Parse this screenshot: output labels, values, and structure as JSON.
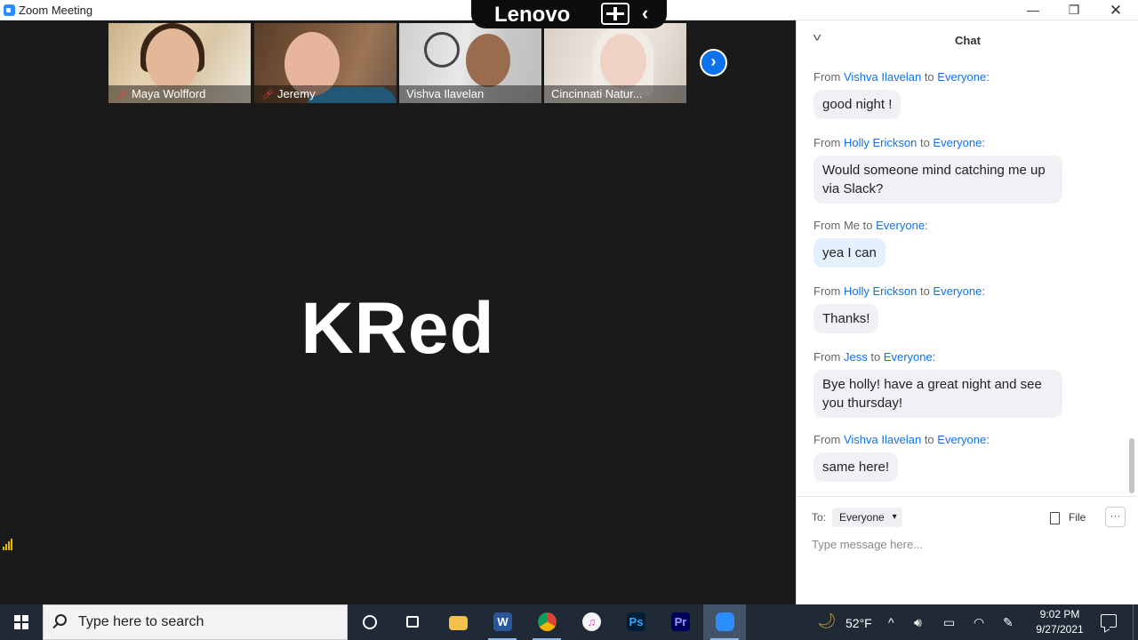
{
  "window": {
    "title": "Zoom Meeting",
    "minimize": "—",
    "restore": "❐",
    "close": "✕"
  },
  "overlay": {
    "brand": "Lenovo",
    "back": "‹"
  },
  "meeting": {
    "participants": [
      {
        "name": "Maya Wolfford",
        "muted": true
      },
      {
        "name": "Jeremy",
        "muted": true
      },
      {
        "name": "Vishva Ilavelan",
        "muted": false
      },
      {
        "name": "Cincinnati Natur...",
        "muted": false
      }
    ],
    "next_arrow": "›",
    "active_speaker": "KRed",
    "mute_glyph": "🎤︎"
  },
  "chat": {
    "title": "Chat",
    "collapse": "˅",
    "from_label": "From",
    "to_label": "to",
    "messages": [
      {
        "sender": "Vishva Ilavelan",
        "recipient": "Everyone:",
        "text": "good night !",
        "mine": false
      },
      {
        "sender": "Holly Erickson",
        "recipient": "Everyone:",
        "text": "Would someone mind catching me up via Slack?",
        "mine": false
      },
      {
        "sender": "Me",
        "recipient": "Everyone:",
        "text": "yea I can",
        "mine": true
      },
      {
        "sender": "Holly Erickson",
        "recipient": "Everyone:",
        "text": "Thanks!",
        "mine": false
      },
      {
        "sender": "Jess",
        "recipient": "Everyone:",
        "text": "Bye holly! have a great night and see you thursday!",
        "mine": false
      },
      {
        "sender": "Vishva Ilavelan",
        "recipient": "Everyone:",
        "text": "same here!",
        "mine": false
      }
    ],
    "to": "To:",
    "recipient_select": "Everyone",
    "file_button": "File",
    "more_button": "···",
    "input_placeholder": "Type message here..."
  },
  "taskbar": {
    "search_placeholder": "Type here to search",
    "apps": [
      "cortana",
      "task-view",
      "file-explorer",
      "word",
      "chrome",
      "itunes",
      "photoshop",
      "premiere",
      "zoom"
    ],
    "word_glyph": "W",
    "itunes_glyph": "♫",
    "ps_glyph": "Ps",
    "pr_glyph": "Pr",
    "weather_icon": "🌙︎",
    "temperature": "52°F",
    "tray": [
      "^",
      "🔊︎",
      "▭",
      "◠",
      "✎"
    ],
    "time": "9:02 PM",
    "date": "9/27/2021"
  }
}
